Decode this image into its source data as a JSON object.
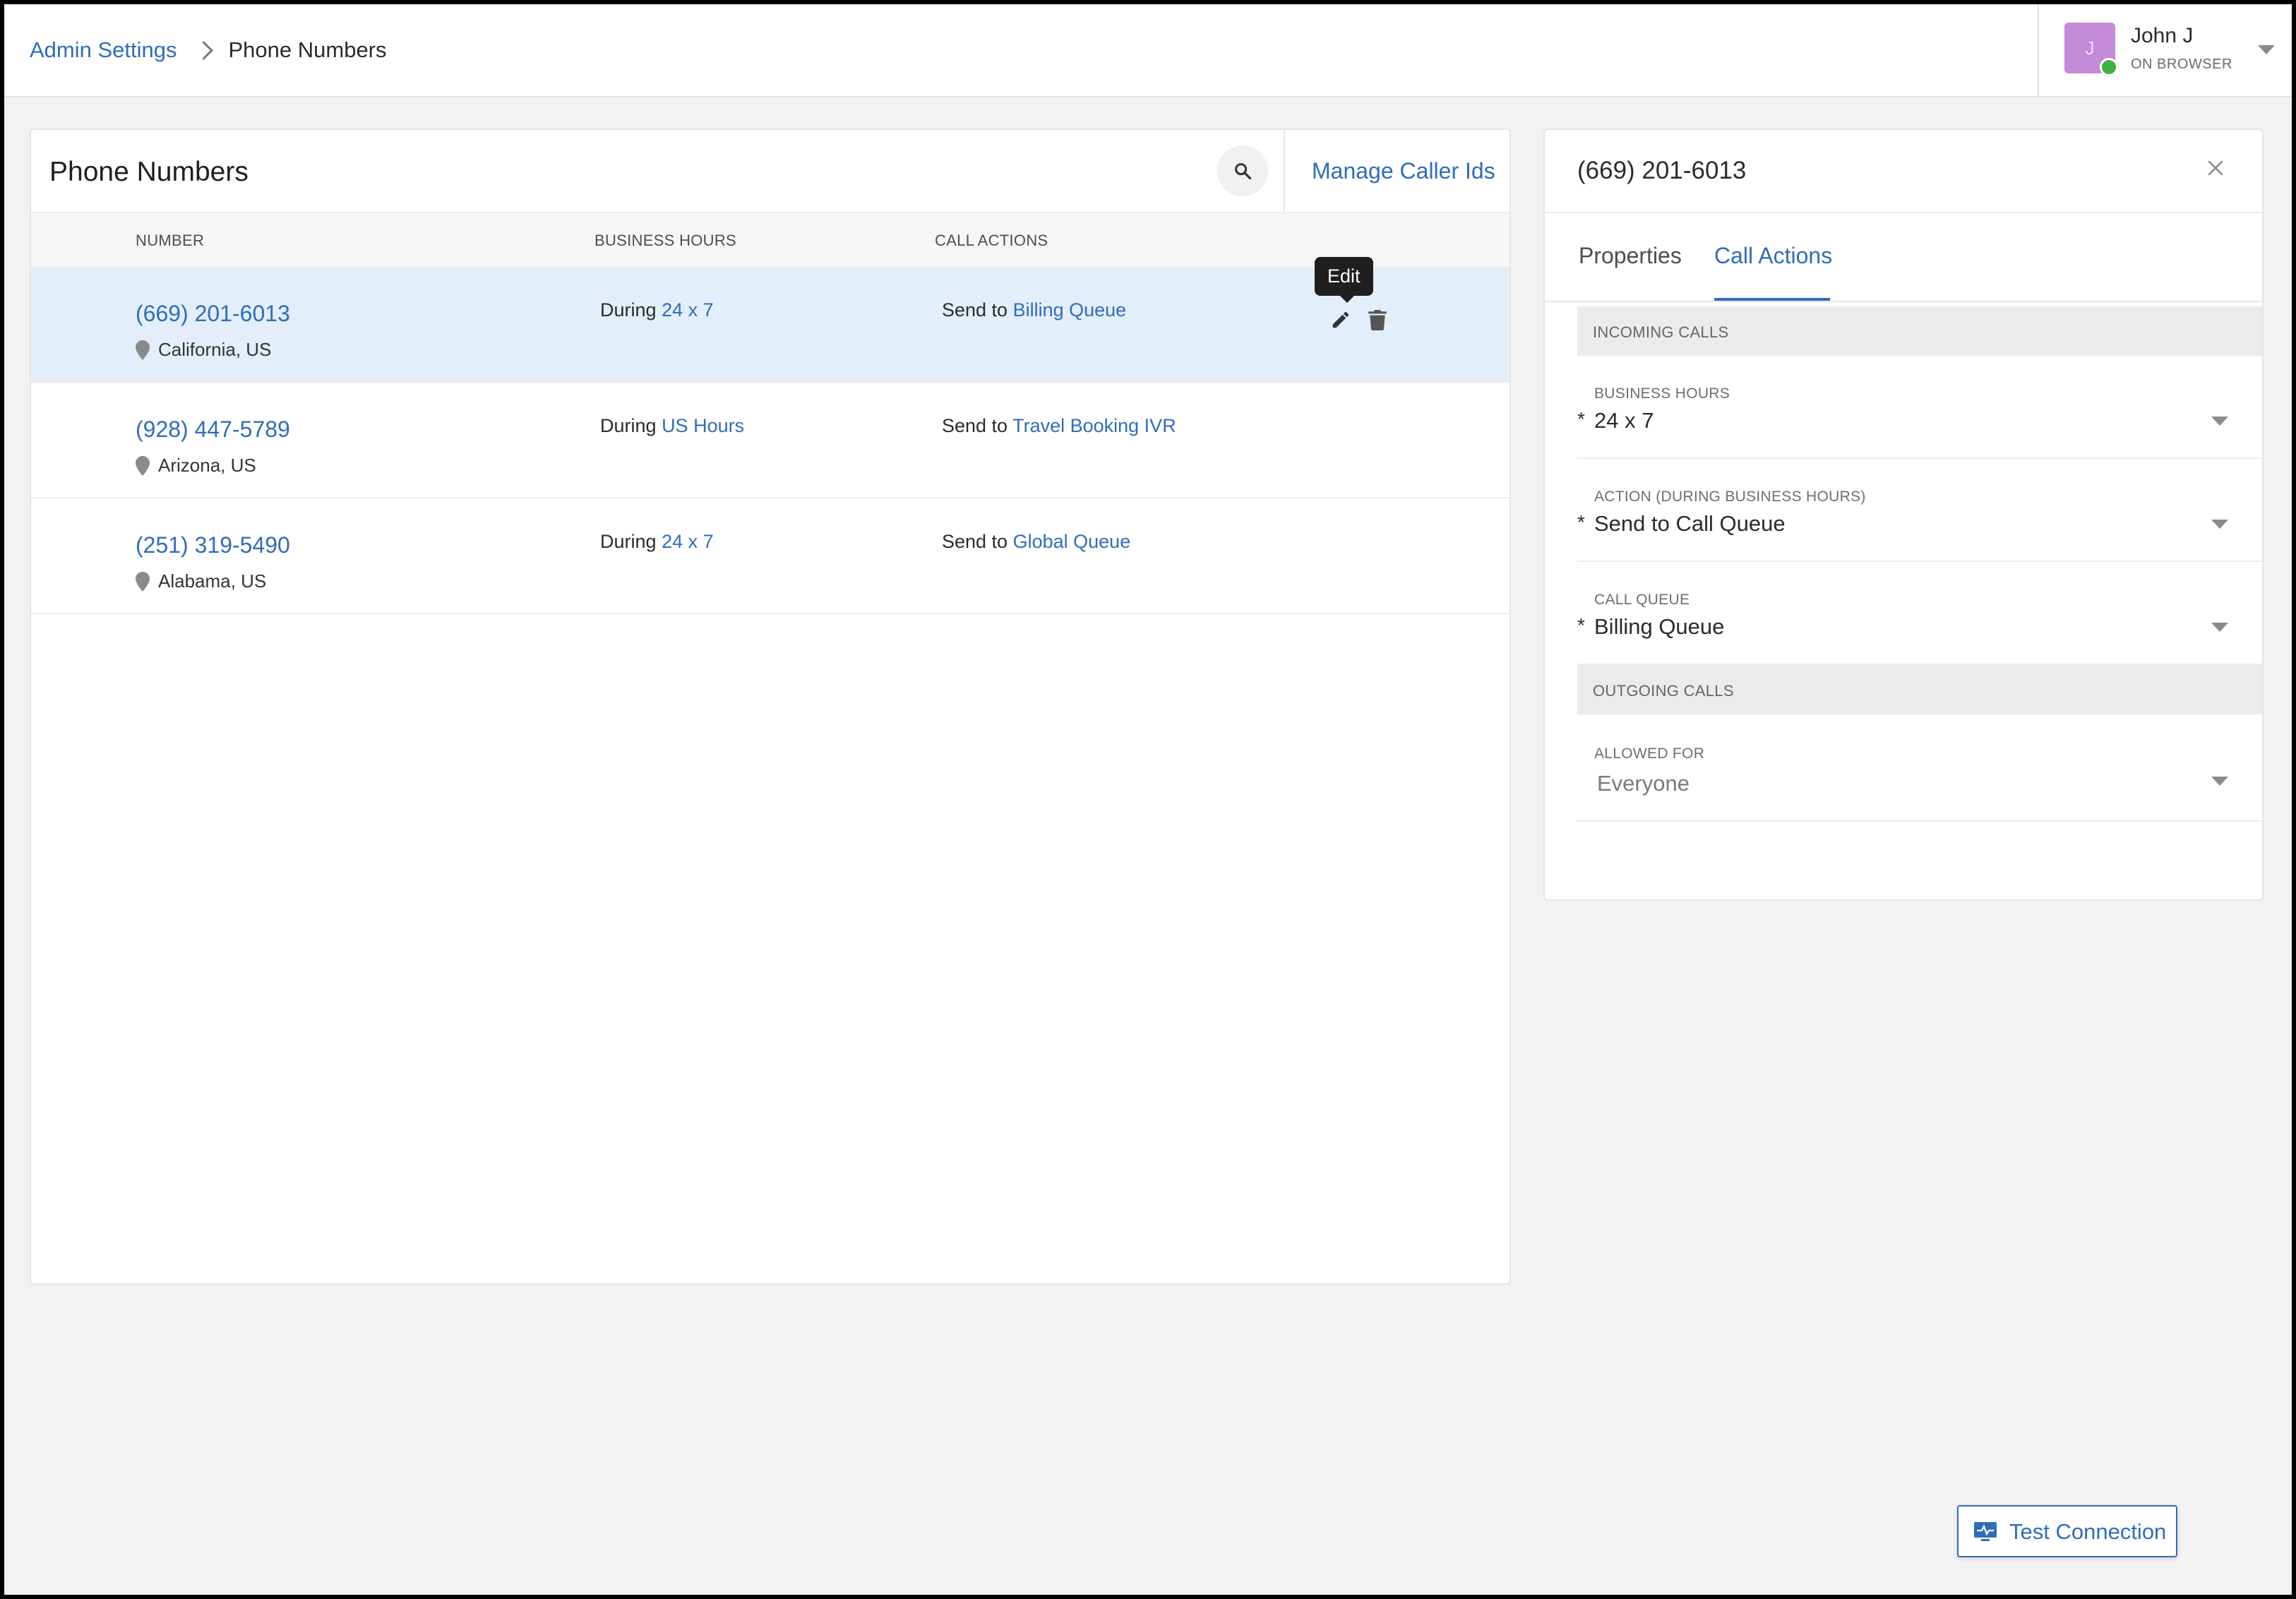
{
  "breadcrumb": {
    "parent": "Admin Settings",
    "current": "Phone Numbers"
  },
  "user": {
    "initial": "J",
    "name": "John J",
    "status": "ON BROWSER",
    "status_color": "#3fb33f",
    "avatar_color": "#c58ad8"
  },
  "numbers_panel": {
    "title": "Phone Numbers",
    "manage_link": "Manage Caller Ids",
    "columns": {
      "number": "NUMBER",
      "hours": "BUSINESS HOURS",
      "actions": "CALL ACTIONS"
    },
    "rows": [
      {
        "number": "(669) 201-6013",
        "location": "California, US",
        "during": "During",
        "hours": "24 x 7",
        "send_to": "Send to",
        "target": "Billing Queue"
      },
      {
        "number": "(928) 447-5789",
        "location": "Arizona, US",
        "during": "During",
        "hours": "US Hours",
        "send_to": "Send to",
        "target": "Travel Booking IVR"
      },
      {
        "number": "(251) 319-5490",
        "location": "Alabama, US",
        "during": "During",
        "hours": "24 x 7",
        "send_to": "Send to",
        "target": "Global Queue"
      }
    ],
    "tooltip": "Edit"
  },
  "details": {
    "title": "(669) 201-6013",
    "tabs": [
      "Properties",
      "Call Actions"
    ],
    "incoming_label": "INCOMING CALLS",
    "business_hours_label": "BUSINESS HOURS",
    "business_hours_value": "24 x 7",
    "action_label": "ACTION (DURING BUSINESS HOURS)",
    "action_value": "Send to Call Queue",
    "queue_label": "CALL QUEUE",
    "queue_value": "Billing Queue",
    "outgoing_label": "OUTGOING CALLS",
    "allowed_label": "ALLOWED FOR",
    "allowed_value": "Everyone",
    "required_mark": "*"
  },
  "test_connection": "Test Connection",
  "colors": {
    "accent": "#2f6dbb",
    "selected_row": "#e3eefa"
  }
}
